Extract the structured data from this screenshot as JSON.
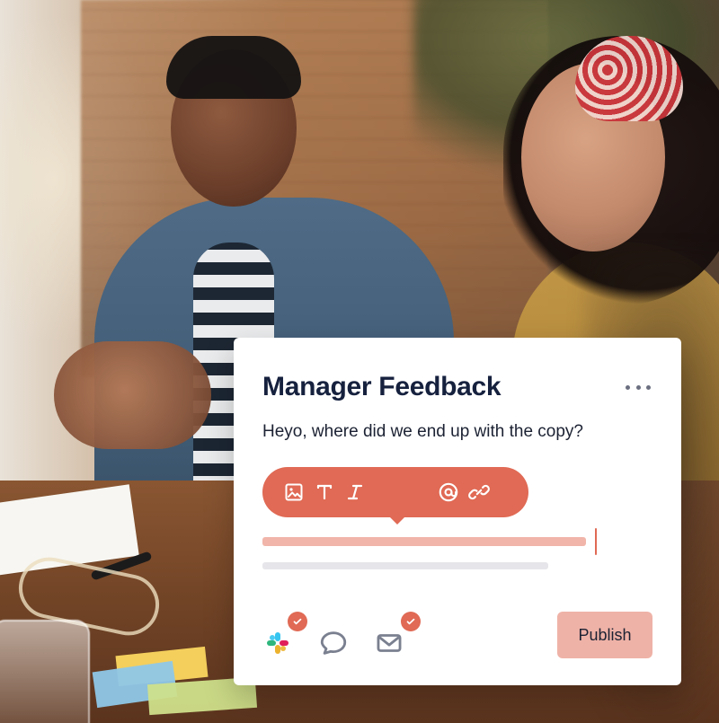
{
  "colors": {
    "accent": "#e06a55",
    "publish_bg": "#efb2a7",
    "title": "#16213e"
  },
  "card": {
    "title": "Manager Feedback",
    "message": "Heyo, where did we end up with the copy?",
    "more_icon": "more-horizontal-icon",
    "toolbar": {
      "icons": [
        "image-icon",
        "text-icon",
        "italic-icon",
        "mention-icon",
        "link-icon"
      ]
    },
    "channels": [
      {
        "icon": "slack-icon",
        "checked": true
      },
      {
        "icon": "chat-bubble-icon",
        "checked": false
      },
      {
        "icon": "mail-icon",
        "checked": true
      }
    ],
    "publish_label": "Publish"
  }
}
